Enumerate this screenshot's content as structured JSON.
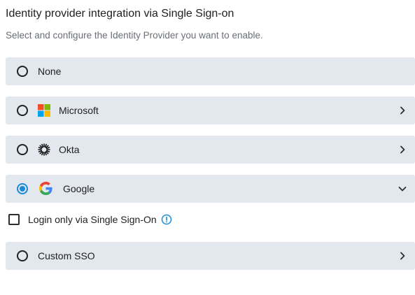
{
  "header": {
    "title": "Identity provider integration via Single Sign-on",
    "subtitle": "Select and configure the Identity Provider you want to enable."
  },
  "options": [
    {
      "label": "None",
      "selected": false,
      "logo": null,
      "chevron": null
    },
    {
      "label": "Microsoft",
      "selected": false,
      "logo": "microsoft-logo",
      "chevron": "chevron-right"
    },
    {
      "label": "Okta",
      "selected": false,
      "logo": "okta-logo",
      "chevron": "chevron-right"
    },
    {
      "label": "Google",
      "selected": true,
      "logo": "google-logo",
      "chevron": "chevron-down"
    },
    {
      "label": "Custom SSO",
      "selected": false,
      "logo": null,
      "chevron": "chevron-right"
    }
  ],
  "google_settings": {
    "login_only_sso_label": "Login only via Single Sign-On",
    "login_only_sso_checked": false,
    "info_icon": "info-circle-icon"
  },
  "colors": {
    "option_bg": "#e3e7ee",
    "accent": "#1a8bd6",
    "text": "#202124",
    "subtext": "#6b6f75"
  }
}
